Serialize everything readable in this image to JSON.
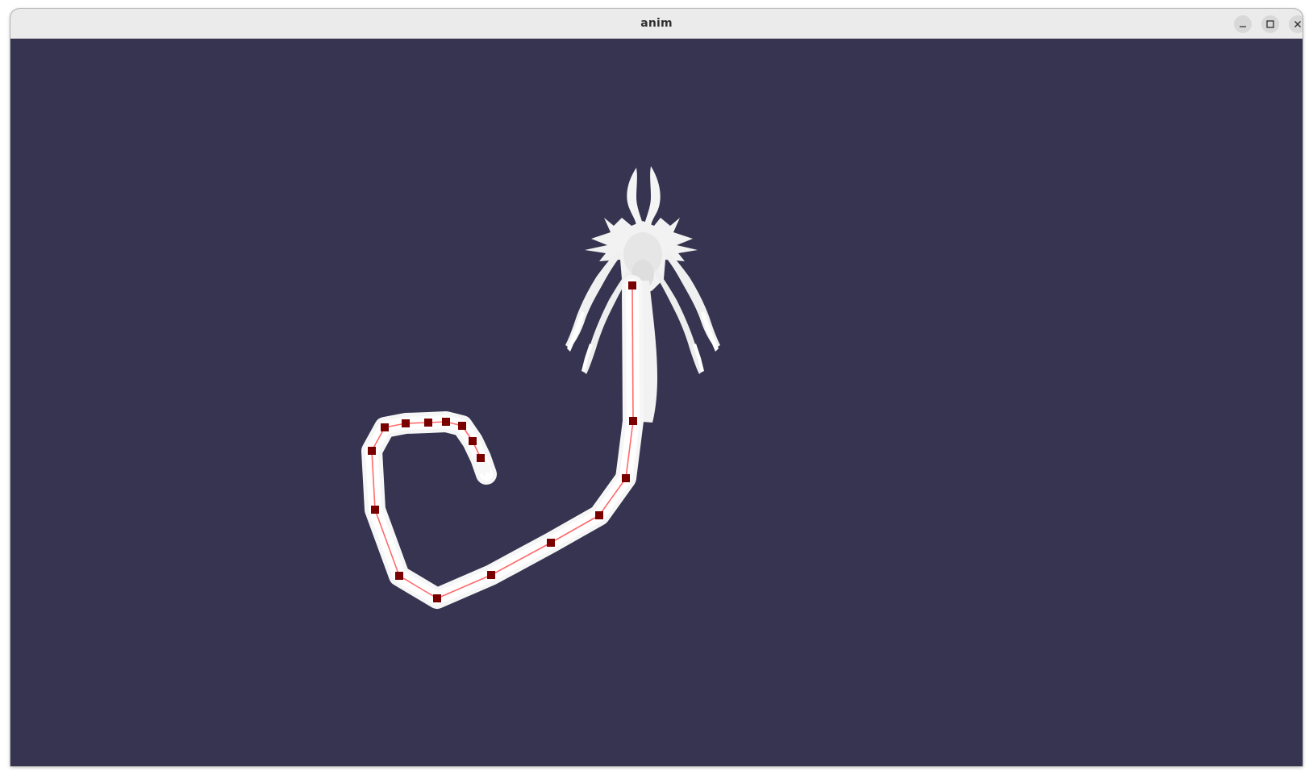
{
  "window": {
    "title": "anim",
    "controls": [
      "minimize-icon",
      "maximize-icon",
      "close-icon"
    ]
  },
  "viewport": {
    "background_color": "#363450",
    "mesh_color": "#ffffff",
    "bone_line_color": "#ff5a5a",
    "joint_color": "#7a0000"
  }
}
